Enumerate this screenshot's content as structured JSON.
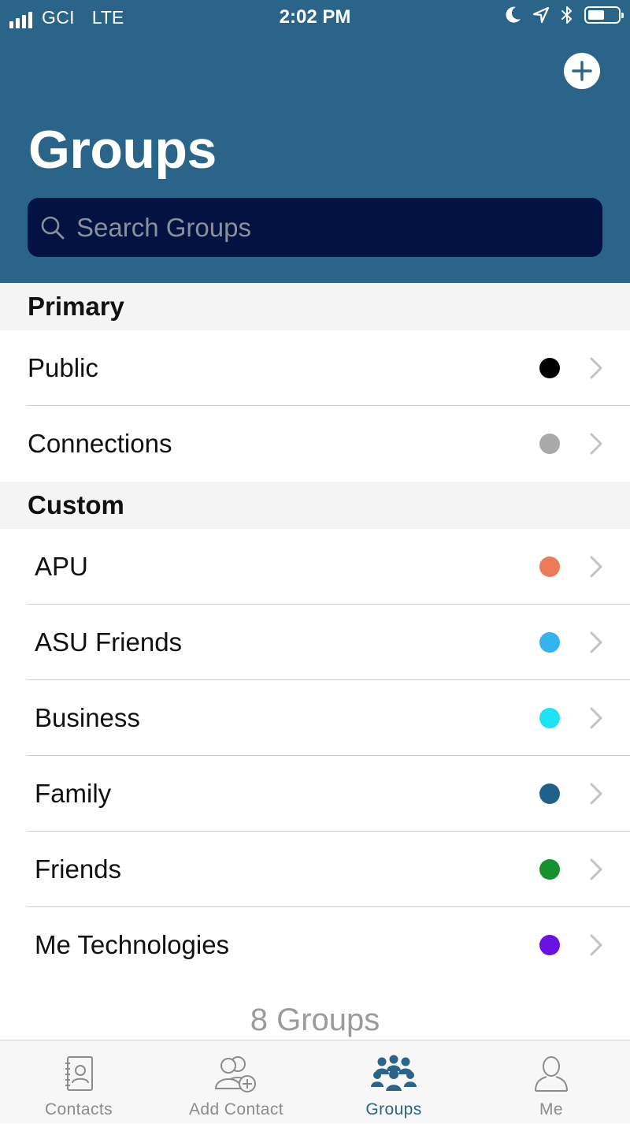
{
  "status_bar": {
    "carrier": "GCI",
    "network": "LTE",
    "time": "2:02 PM",
    "battery_level": 0.55,
    "icons": [
      "moon-icon",
      "location-arrow-icon",
      "bluetooth-icon",
      "battery-icon"
    ]
  },
  "header": {
    "title": "Groups",
    "add_button_icon": "plus-icon"
  },
  "search": {
    "placeholder": "Search Groups",
    "value": ""
  },
  "sections": {
    "primary": {
      "title": "Primary",
      "items": [
        {
          "label": "Public",
          "color": "#000000"
        },
        {
          "label": "Connections",
          "color": "#a9a9a9"
        }
      ]
    },
    "custom": {
      "title": "Custom",
      "items": [
        {
          "label": "APU",
          "color": "#ec7b57"
        },
        {
          "label": "ASU Friends",
          "color": "#33b4ef"
        },
        {
          "label": "Business",
          "color": "#1ee3f5"
        },
        {
          "label": "Family",
          "color": "#1f618a"
        },
        {
          "label": "Friends",
          "color": "#15922f"
        },
        {
          "label": "Me Technologies",
          "color": "#6913e2"
        }
      ]
    }
  },
  "footer": {
    "group_count": "8 Groups"
  },
  "tab_bar": {
    "tabs": [
      {
        "label": "Contacts",
        "icon": "address-book-icon",
        "active": false
      },
      {
        "label": "Add Contact",
        "icon": "add-contact-icon",
        "active": false
      },
      {
        "label": "Groups",
        "icon": "groups-icon",
        "active": true
      },
      {
        "label": "Me",
        "icon": "person-icon",
        "active": false
      }
    ]
  },
  "colors": {
    "header_background": "#2a6589",
    "search_background": "#021342",
    "accent": "#2a6589",
    "section_background": "#f4f4f4"
  }
}
